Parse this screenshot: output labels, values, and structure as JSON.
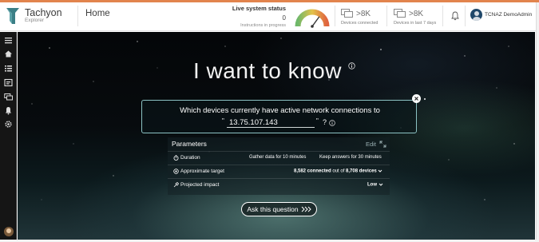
{
  "brand": {
    "name": "Tachyon",
    "sub": "Explorer"
  },
  "header": {
    "page_title": "Home"
  },
  "status": {
    "label": "Live system status",
    "value": "0",
    "sub": "Instructions in progress",
    "gauge_level": 0.7
  },
  "metrics": [
    {
      "value": ">8K",
      "label": "Devices connected",
      "icon": "monitor-icon"
    },
    {
      "value": ">8K",
      "label": "Devices in last 7 days",
      "icon": "monitor-icon"
    }
  ],
  "user": {
    "name": "TCNAZ DemoAdmin"
  },
  "nav": [
    "menu-icon",
    "home-icon",
    "list-icon",
    "instructions-icon",
    "devices-icon",
    "bell-icon",
    "gear-icon"
  ],
  "main": {
    "headline": "I want to know",
    "question": {
      "text": "Which devices currently have active network connections to",
      "value": "13.75.107.143",
      "quote_open": "\"",
      "quote_close": "\"",
      "suffix": "?"
    },
    "params": {
      "title": "Parameters",
      "edit_label": "Edit",
      "duration": {
        "label": "Duration",
        "gather": "Gather data for 10 minutes",
        "keep": "Keep answers for 30 minutes"
      },
      "target": {
        "label": "Approximate target",
        "connected": "8,582 connected",
        "out_of": "out of",
        "total": "8,708 devices"
      },
      "impact": {
        "label": "Projected impact",
        "value": "Low"
      }
    },
    "ask_button": "Ask this question"
  },
  "colors": {
    "accent": "#e2844d",
    "query_border": "#8cc3c4",
    "nav_bg": "#151515"
  }
}
